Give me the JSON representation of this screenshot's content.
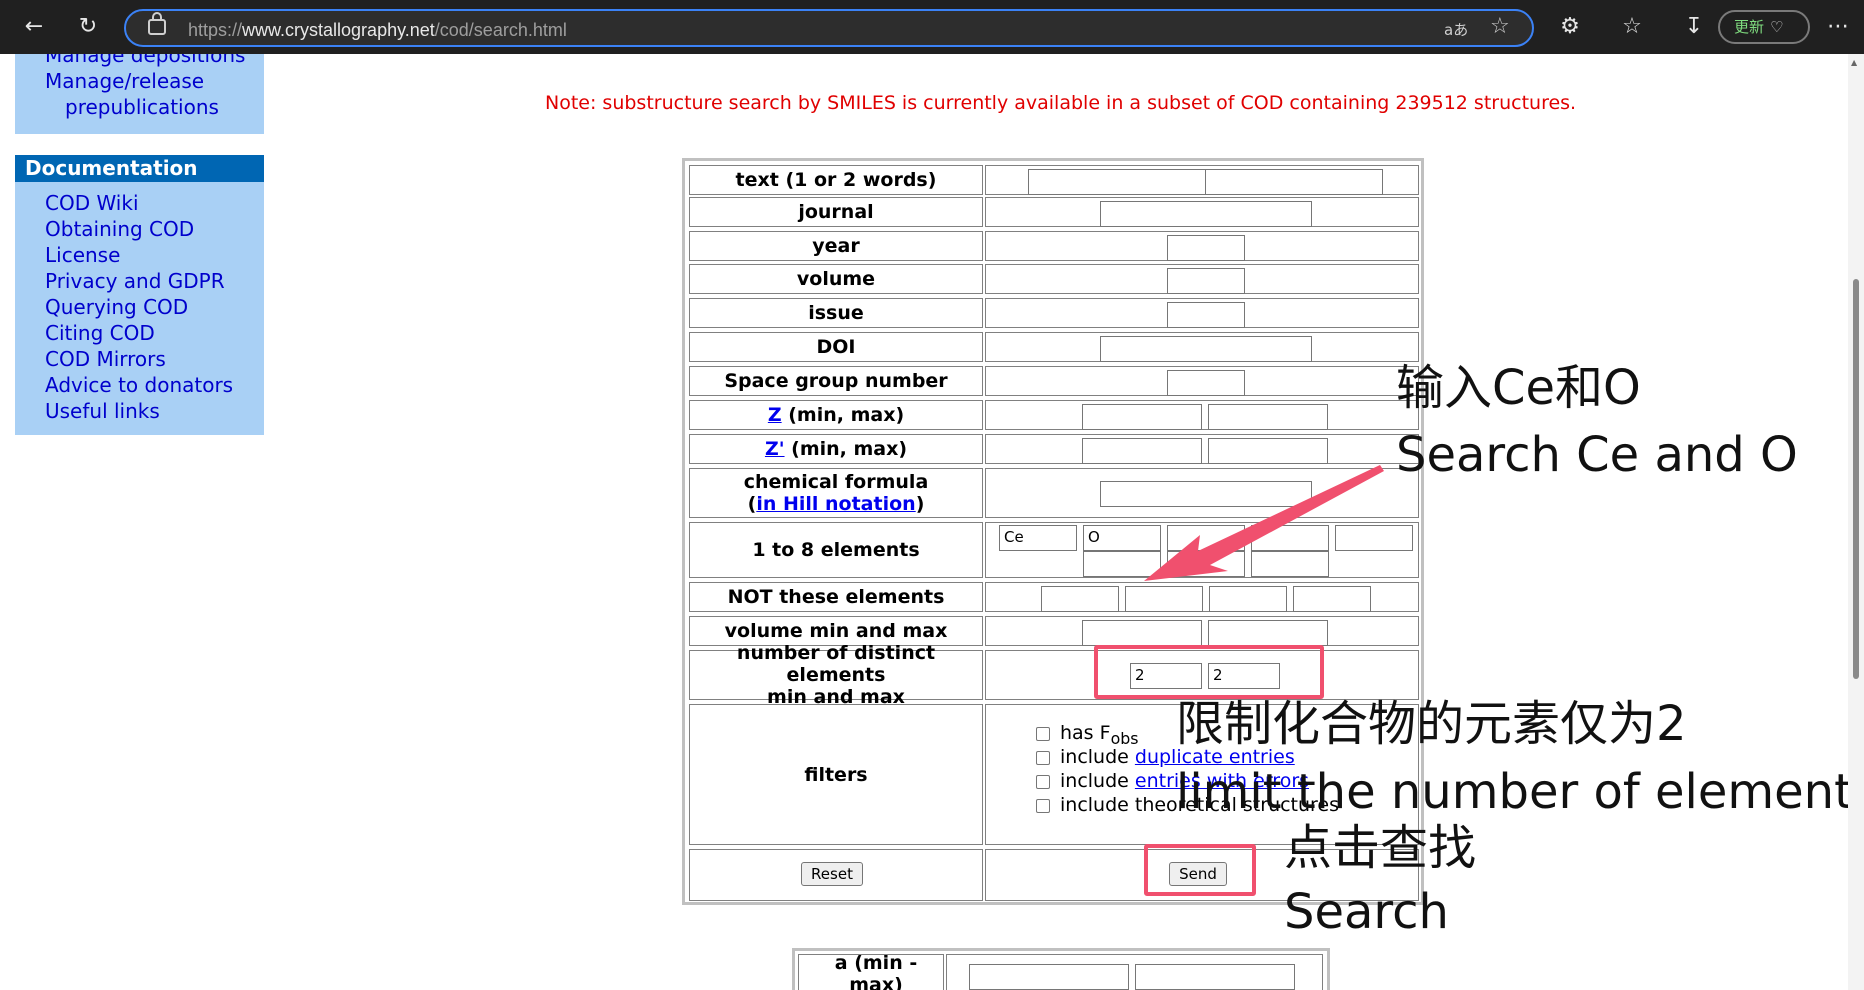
{
  "browser": {
    "url_scheme": "https://",
    "url_host": "www.crystallography.net",
    "url_path": "/cod/search.html",
    "reader_label": "aあ",
    "update_label": "更新"
  },
  "sidebar": {
    "manage_items": [
      "Manage depositions",
      "Manage/release",
      "prepublications"
    ],
    "documentation_header": "Documentation",
    "doc_items": [
      "COD Wiki",
      "Obtaining COD",
      "License",
      "Privacy and GDPR",
      "Querying COD",
      "Citing COD",
      "COD Mirrors",
      "Advice to donators",
      "Useful links"
    ]
  },
  "note": "Note: substructure search by SMILES is currently available in a subset of COD containing 239512 structures.",
  "form": {
    "labels": {
      "text": "text (1 or 2 words)",
      "journal": "journal",
      "year": "year",
      "volume": "volume",
      "issue": "issue",
      "doi": "DOI",
      "spacegroup": "Space group number",
      "z_link": "Z",
      "z_rest": " (min, max)",
      "zp_link": "Z'",
      "zp_rest": " (min, max)",
      "formula_line1": "chemical formula",
      "formula_open": "(",
      "formula_link": "in Hill notation",
      "formula_close": ")",
      "elements": "1 to 8 elements",
      "not_elements": "NOT these elements",
      "volume_minmax": "volume min and max",
      "distinct_line1": "number of distinct elements",
      "distinct_line2": "min and max",
      "filters": "filters"
    },
    "elements_values": [
      "Ce",
      "O",
      "",
      "",
      "",
      "",
      "",
      ""
    ],
    "distinct_min": "2",
    "distinct_max": "2",
    "filters": {
      "fobs_prefix": "has F",
      "fobs_sub": "obs",
      "duplicate_prefix": "include ",
      "duplicate_link": "duplicate entries",
      "errors_prefix": "include ",
      "errors_link": "entries with errors",
      "theoretical": "include theoretical structures"
    },
    "reset_label": "Reset",
    "send_label": "Send"
  },
  "cell_table": {
    "a_label": "a (min - max)"
  },
  "annotations": {
    "elements_cn": "输入Ce和O",
    "elements_en": "Search Ce and O",
    "limit_cn": "限制化合物的元素仅为2",
    "limit_en": "limit the number of elements",
    "search_cn": "点击查找",
    "search_en": "Search"
  },
  "colors": {
    "note": "#e00000",
    "sidebar_bg": "#a9d0f5",
    "doc_header_bg": "#0066b3",
    "annotation_red": "#f0506e"
  }
}
